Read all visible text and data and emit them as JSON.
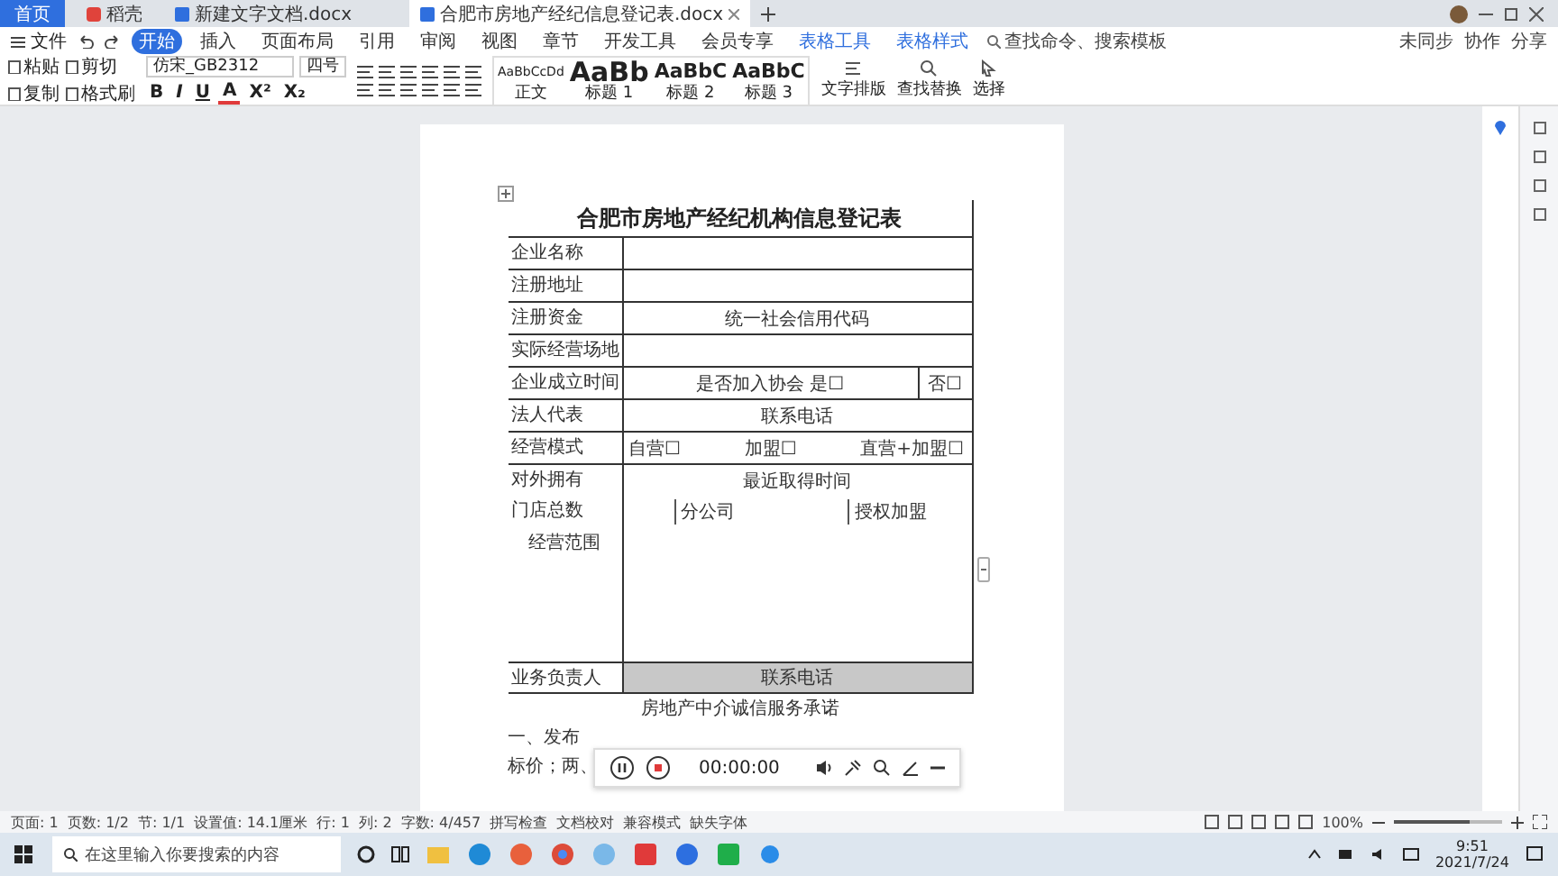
{
  "tabs": [
    {
      "label": "首页",
      "kind": "home",
      "selected": false
    },
    {
      "label": "稻壳",
      "kind": "app",
      "selected": false
    },
    {
      "label": "新建文字文档.docx",
      "kind": "doc",
      "selected": false
    },
    {
      "label": "合肥市房地产经纪信息登记表.docx",
      "kind": "doc",
      "selected": true
    }
  ],
  "menu": {
    "file": "文件",
    "items": [
      {
        "label": "开始",
        "selected": true
      },
      {
        "label": "插入",
        "selected": false
      },
      {
        "label": "页面布局",
        "selected": false
      },
      {
        "label": "引用",
        "selected": false
      },
      {
        "label": "审阅",
        "selected": false
      },
      {
        "label": "视图",
        "selected": false
      },
      {
        "label": "章节",
        "selected": false
      },
      {
        "label": "开发工具",
        "selected": false
      },
      {
        "label": "会员专享",
        "selected": false
      },
      {
        "label": "表格工具",
        "selected": false
      },
      {
        "label": "表格样式",
        "selected": false
      }
    ],
    "search": "查找命令、搜索模板",
    "right": [
      "未同步",
      "协作",
      "分享"
    ]
  },
  "ribbon": {
    "clipboard": [
      "粘贴",
      "剪切",
      "复制",
      "格式刷"
    ],
    "font": "仿宋_GB2312",
    "size": "四号",
    "format": [
      "B",
      "I",
      "U",
      "A",
      "X²",
      "X₂"
    ],
    "styles": [
      {
        "preview": "AaBbCcDd",
        "label": "正文"
      },
      {
        "preview": "AaBb",
        "label": "标题 1"
      },
      {
        "preview": "AaBbC",
        "label": "标题 2"
      },
      {
        "preview": "AaBbC",
        "label": "标题 3"
      }
    ],
    "tools": [
      "文字排版",
      "查找替换",
      "选择"
    ]
  },
  "form": {
    "title": "合肥市房地产经纪机构信息登记表",
    "rows": [
      {
        "kind": "line",
        "label": "企业名称",
        "fields": []
      },
      {
        "kind": "line",
        "label": "注册地址",
        "fields": []
      },
      {
        "kind": "line",
        "label": "注册资金",
        "fields": [
          {
            "kind": "center",
            "text": "统一社会信用代码"
          }
        ]
      },
      {
        "kind": "line",
        "label": "实际经营场地",
        "fields": []
      },
      {
        "kind": "line",
        "label": "企业成立时间",
        "fields": [
          {
            "kind": "center",
            "text": "是否加入协会  是☐"
          },
          {
            "kind": "box",
            "text": "否☐"
          }
        ]
      },
      {
        "kind": "line",
        "label": "法人代表",
        "fields": [
          {
            "kind": "center",
            "text": "联系电话"
          }
        ]
      },
      {
        "kind": "line",
        "label": "经营模式",
        "fields": [
          {
            "kind": "plain",
            "text": "自营☐"
          },
          {
            "kind": "plain",
            "text": "加盟☐"
          },
          {
            "kind": "plain",
            "text": "直营+加盟☐"
          }
        ]
      },
      {
        "kind": "line",
        "label": "对外拥有",
        "fields": [
          {
            "kind": "center",
            "text": "最近取得时间"
          }
        ]
      },
      {
        "kind": "open",
        "label": "门店总数",
        "fields": [
          {
            "kind": "split",
            "text": "分公司"
          },
          {
            "kind": "split",
            "text": "授权加盟"
          }
        ]
      },
      {
        "kind": "vertical",
        "label": "经营范围",
        "fields": []
      },
      {
        "kind": "shaded",
        "label": "业务负责人",
        "fields": [
          {
            "kind": "center",
            "text": "联系电话"
          }
        ]
      }
    ]
  },
  "after": [
    {
      "kind": "heading",
      "text": "房地产中介诚信服务承诺"
    },
    {
      "kind": "para",
      "text": "一、发布"
    },
    {
      "kind": "para",
      "text": "标价；两、"
    }
  ],
  "recorder": {
    "time": "00:00:00"
  },
  "status": [
    "页面: 1",
    "页数: 1/2",
    "节: 1/1",
    "设置值: 14.1厘米",
    "行: 1",
    "列: 2",
    "字数: 4/457",
    "拼写检查",
    "文档校对",
    "兼容模式",
    "缺失字体"
  ],
  "zoom": {
    "label": "100%",
    "level": 0.7
  },
  "taskbar": {
    "search": "在这里输入你要搜索的内容",
    "time": "9:51",
    "date": "2021/7/24"
  }
}
